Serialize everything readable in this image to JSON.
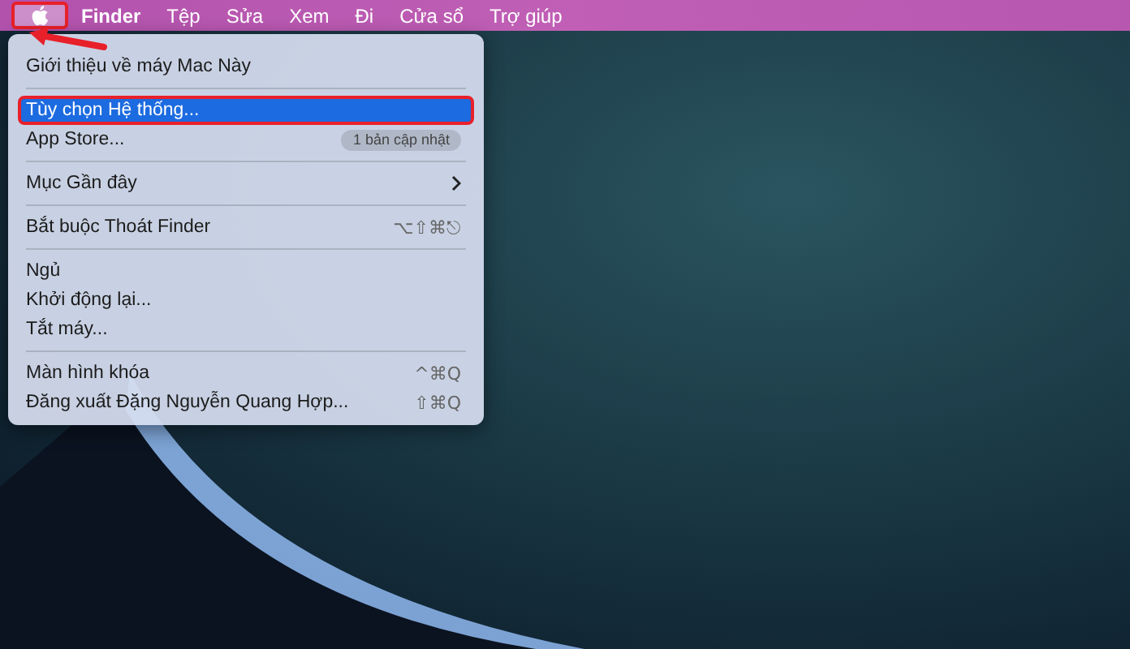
{
  "menu_bar": {
    "items": [
      {
        "kind": "apple",
        "selected": true,
        "outlined": true
      },
      {
        "kind": "app",
        "label": "Finder",
        "selected": false,
        "outlined": false
      },
      {
        "kind": "menu",
        "label": "Tệp",
        "selected": false,
        "outlined": false
      },
      {
        "kind": "menu",
        "label": "Sửa",
        "selected": false,
        "outlined": false
      },
      {
        "kind": "menu",
        "label": "Xem",
        "selected": false,
        "outlined": false
      },
      {
        "kind": "menu",
        "label": "Đi",
        "selected": false,
        "outlined": false
      },
      {
        "kind": "menu",
        "label": "Cửa sổ",
        "selected": false,
        "outlined": false
      },
      {
        "kind": "menu",
        "label": "Trợ giúp",
        "selected": false,
        "outlined": false
      }
    ]
  },
  "apple_menu": {
    "items": [
      {
        "kind": "item",
        "label": "Giới thiệu về máy Mac Này",
        "selected": false,
        "outlined": false
      },
      {
        "kind": "separator"
      },
      {
        "kind": "item",
        "label": "Tùy chọn Hệ thống...",
        "selected": true,
        "outlined": true
      },
      {
        "kind": "item",
        "label": "App Store...",
        "badge": "1 bản cập nhật",
        "selected": false,
        "outlined": false
      },
      {
        "kind": "separator"
      },
      {
        "kind": "item",
        "label": "Mục Gần đây",
        "submenu": true,
        "selected": false,
        "outlined": false
      },
      {
        "kind": "separator"
      },
      {
        "kind": "item",
        "label": "Bắt buộc Thoát Finder",
        "shortcut": "⌥⇧⌘⎋",
        "selected": false,
        "outlined": false
      },
      {
        "kind": "separator"
      },
      {
        "kind": "item",
        "label": "Ngủ",
        "selected": false,
        "outlined": false
      },
      {
        "kind": "item",
        "label": "Khởi động lại...",
        "selected": false,
        "outlined": false
      },
      {
        "kind": "item",
        "label": "Tắt máy...",
        "selected": false,
        "outlined": false
      },
      {
        "kind": "separator"
      },
      {
        "kind": "item",
        "label": "Màn hình khóa",
        "shortcut": "^⌘Q",
        "selected": false,
        "outlined": false
      },
      {
        "kind": "item",
        "label": "Đăng xuất Đặng Nguyễn Quang Hợp...",
        "shortcut": "⇧⌘Q",
        "selected": false,
        "outlined": false
      }
    ]
  }
}
